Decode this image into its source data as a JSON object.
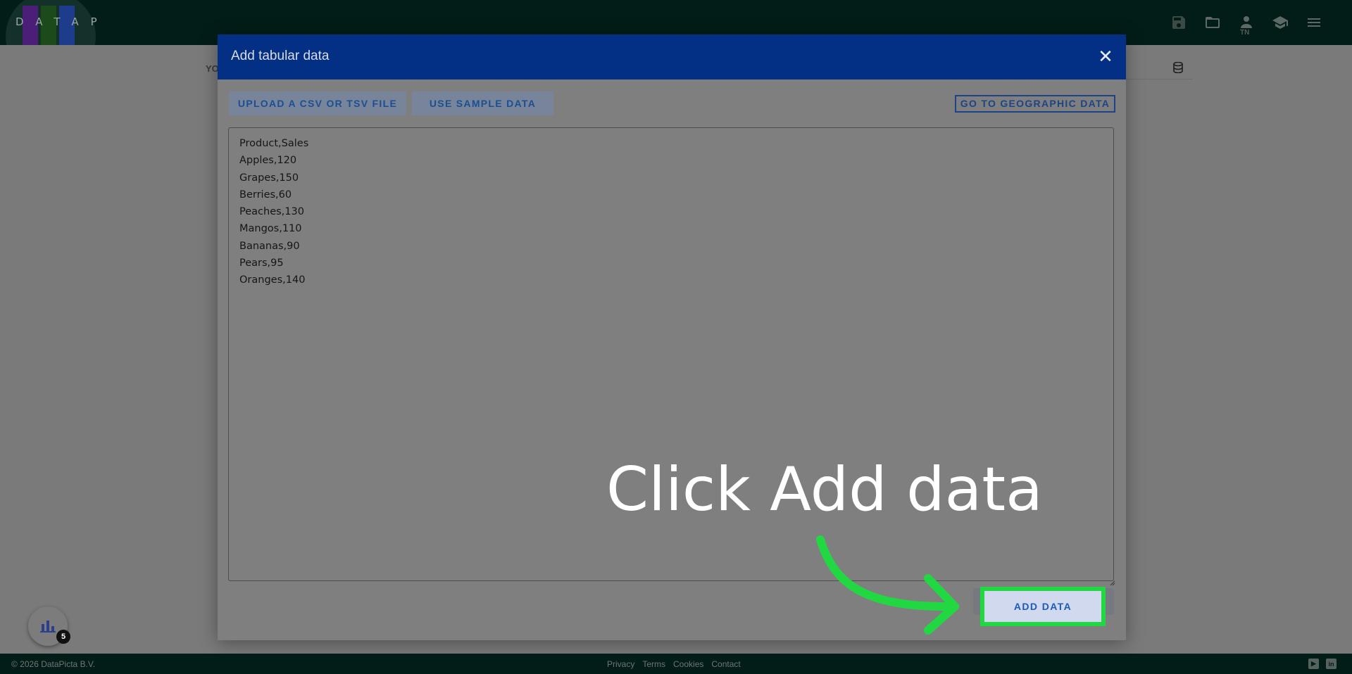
{
  "app": {
    "logo_text": "DATAPICTA",
    "colors": {
      "topbar": "#021d17",
      "modal_header": "#032f85",
      "highlight": "#21d843"
    }
  },
  "header_icons": [
    {
      "name": "save-icon"
    },
    {
      "name": "folder-open-icon"
    },
    {
      "name": "user-icon",
      "badge": "TN"
    },
    {
      "name": "graduation-cap-icon"
    },
    {
      "name": "hamburger-menu-icon"
    }
  ],
  "background_page": {
    "partial_label": "YO"
  },
  "modal": {
    "title": "Add tabular data",
    "close_label": "✕",
    "upload_button": "UPLOAD A CSV OR TSV FILE",
    "sample_button": "USE SAMPLE DATA",
    "geo_button": "GO TO GEOGRAPHIC DATA",
    "textarea_value": "Product,Sales\nApples,120\nGrapes,150\nBerries,60\nPeaches,130\nMangos,110\nBananas,90\nPears,95\nOranges,140",
    "add_data_button": "ADD DATA"
  },
  "annotation": {
    "text": "Click Add data"
  },
  "fab": {
    "icon": "bar-chart-icon",
    "count": "5"
  },
  "footer": {
    "copyright": "© 2026 DataPicta B.V.",
    "links": [
      "Privacy",
      "Terms",
      "Cookies",
      "Contact"
    ],
    "social": [
      "youtube-icon",
      "linkedin-icon"
    ]
  }
}
